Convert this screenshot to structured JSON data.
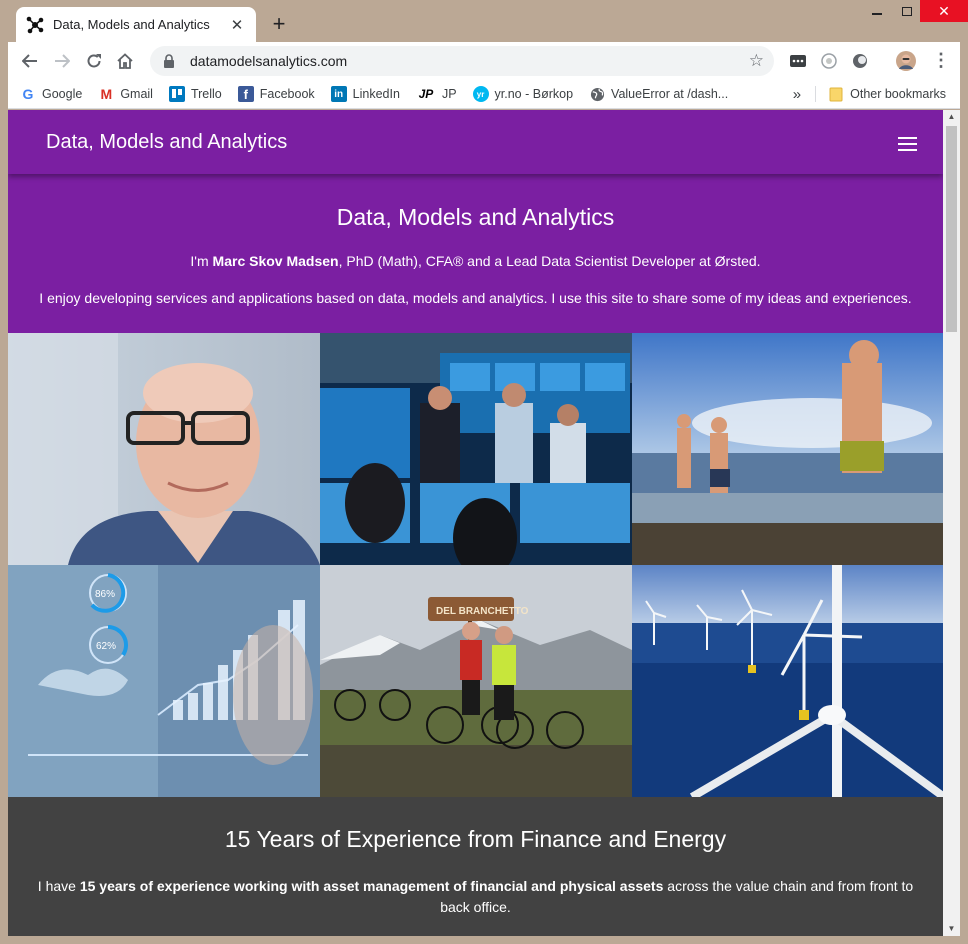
{
  "browser": {
    "tab_title": "Data, Models and Analytics",
    "url": "datamodelsanalytics.com",
    "bookmarks": [
      "Google",
      "Gmail",
      "Trello",
      "Facebook",
      "LinkedIn",
      "JP",
      "yr.no - Børkop",
      "ValueError at /dash..."
    ],
    "other_bookmarks": "Other bookmarks",
    "overflow_glyph": "»"
  },
  "navbar": {
    "brand": "Data, Models and Analytics"
  },
  "hero": {
    "title": "Data, Models and Analytics",
    "intro_prefix": "I'm ",
    "intro_name": "Marc Skov Madsen",
    "intro_suffix": ", PhD (Math), CFA® and a Lead Data Scientist Developer at Ørsted.",
    "description": "I enjoy developing services and applications based on data, models and analytics. I use this site to share some of my ideas and experiences."
  },
  "gallery": {
    "gauge_1": "86%",
    "gauge_2": "62%",
    "sign_text": "DEL BRANCHETTO"
  },
  "experience": {
    "title": "15 Years of Experience from Finance and Energy",
    "text_prefix": "I have ",
    "text_bold": "15 years of experience working with asset management of financial and physical assets",
    "text_suffix": " across the value chain and from front to back office."
  },
  "colors": {
    "primary": "#7b1fa2",
    "dark_section": "#424242",
    "frame": "#bba895"
  }
}
